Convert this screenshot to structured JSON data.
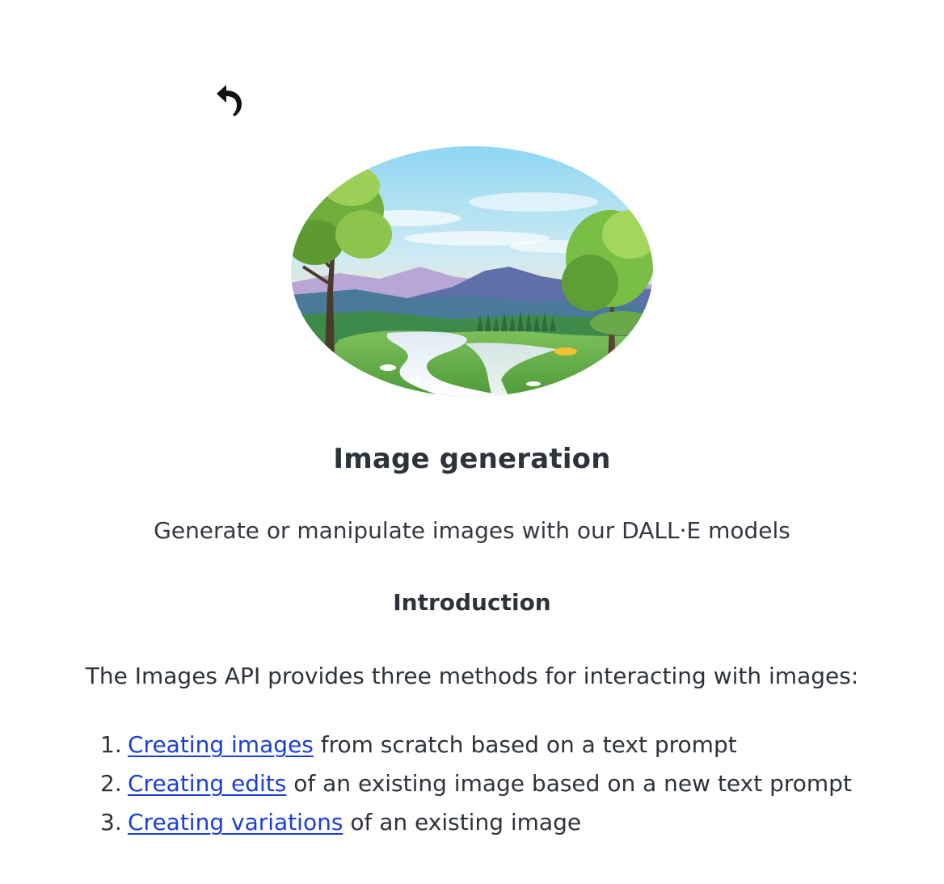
{
  "page": {
    "title": "Image generation",
    "subtitle": "Generate or manipulate images with our DALL·E models"
  },
  "introduction": {
    "heading": "Introduction",
    "text": "The Images API provides three methods for interacting with images:"
  },
  "methods": [
    {
      "number": "1.",
      "link": "Creating images",
      "rest": " from scratch based on a text prompt"
    },
    {
      "number": "2.",
      "link": "Creating edits",
      "rest": " of an existing image based on a new text prompt"
    },
    {
      "number": "3.",
      "link": "Creating variations",
      "rest": " of an existing image"
    }
  ],
  "colors": {
    "link": "#1a3fd6",
    "text": "#2d333a"
  },
  "icons": {
    "back": "undo-arrow-icon",
    "hero": "landscape-illustration"
  }
}
